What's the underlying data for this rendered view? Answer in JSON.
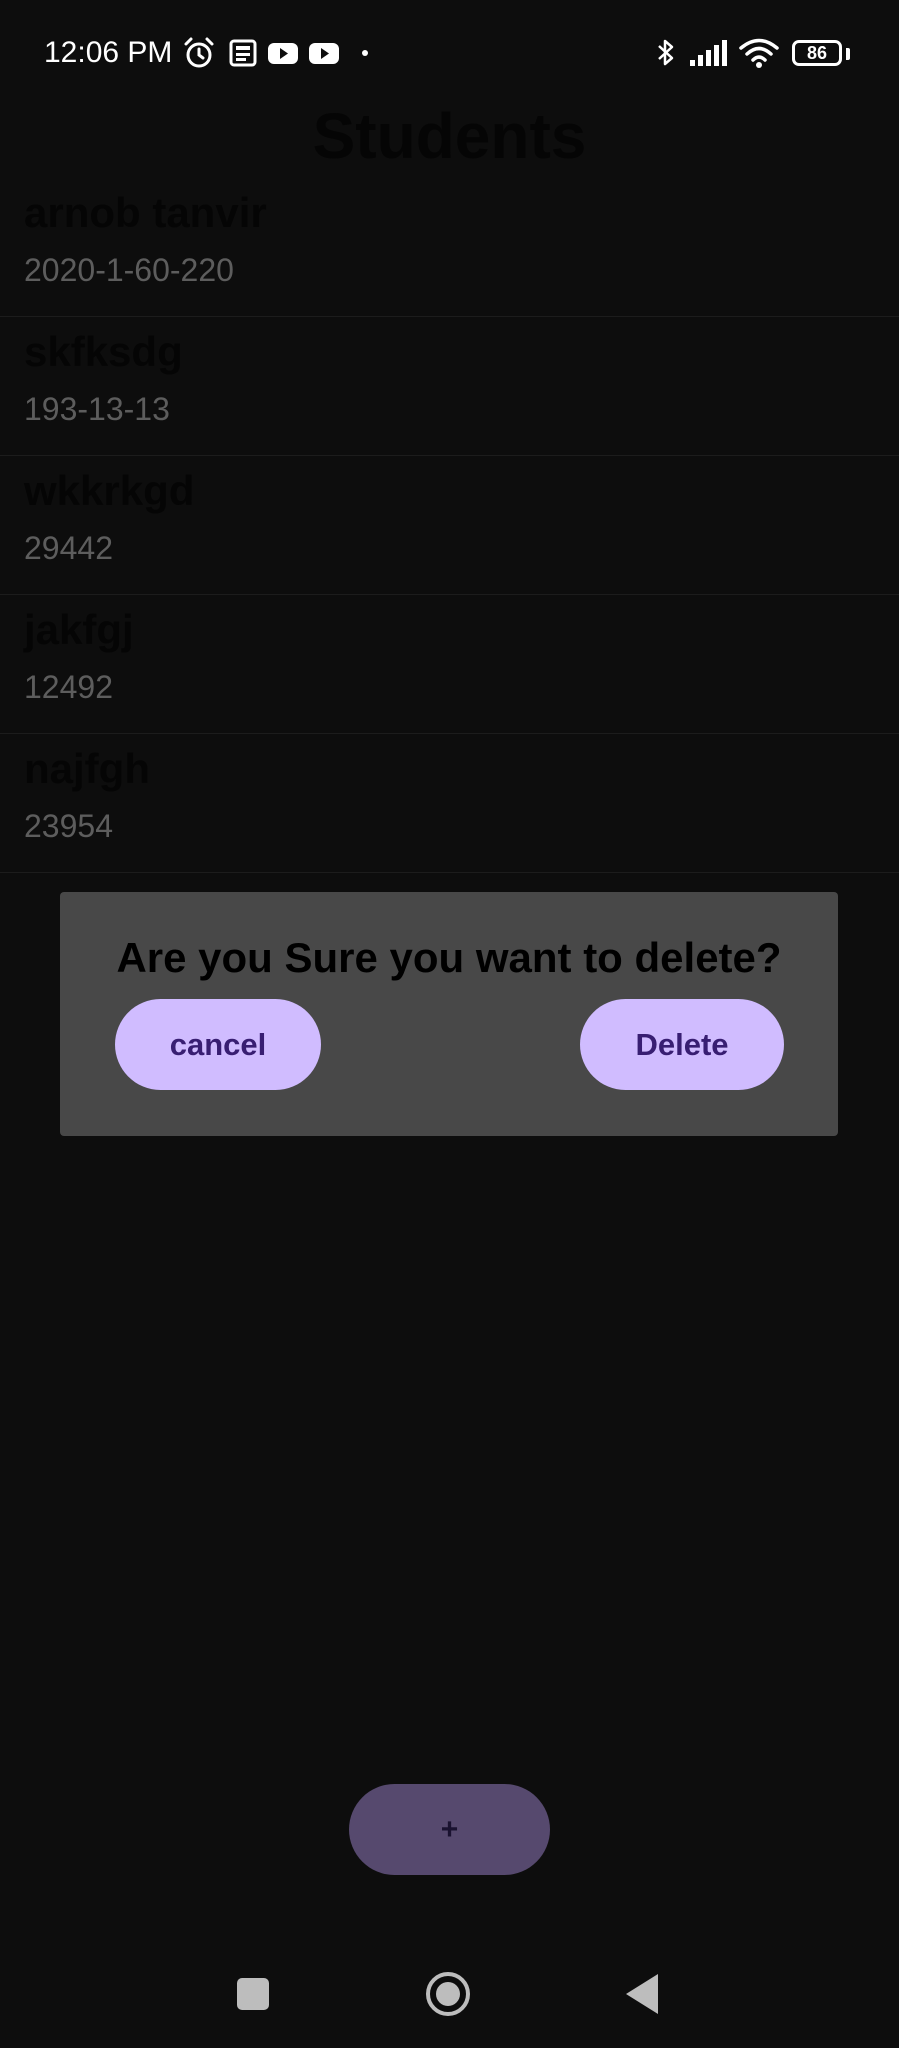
{
  "status_bar": {
    "time": "12:06 PM",
    "battery": "86",
    "icons": [
      "alarm-icon",
      "news-icon",
      "youtube-icon",
      "youtube-icon",
      "bluetooth-icon",
      "signal-icon",
      "wifi-icon",
      "battery-icon"
    ]
  },
  "page": {
    "title": "Students"
  },
  "students": [
    {
      "name": "arnob tanvir",
      "id": "2020-1-60-220"
    },
    {
      "name": "skfksdg",
      "id": "193-13-13"
    },
    {
      "name": "wkkrkgd",
      "id": "29442"
    },
    {
      "name": "jakfgj",
      "id": "12492"
    },
    {
      "name": "najfgh",
      "id": "23954"
    }
  ],
  "dialog": {
    "message": "Are you Sure you want to delete?",
    "cancel_label": "cancel",
    "delete_label": "Delete"
  },
  "fab": {
    "label": "+"
  },
  "colors": {
    "background": "#0d0d0d",
    "dialog_bg": "#484848",
    "button_bg": "#d0bcff",
    "button_text": "#381e72",
    "fab_bg": "#56496e"
  },
  "nav_bar": {
    "icons": [
      "recents-square-icon",
      "home-circle-icon",
      "back-triangle-icon"
    ]
  }
}
